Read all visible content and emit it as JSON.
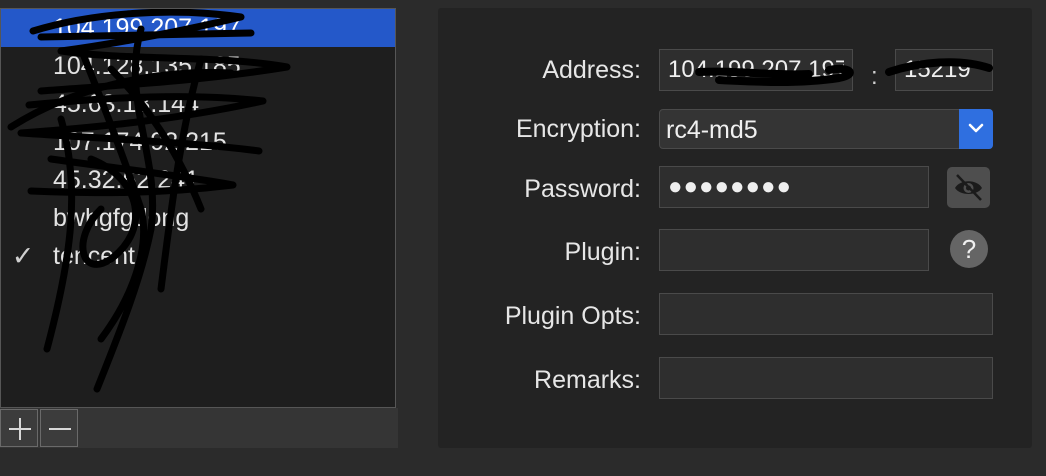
{
  "server_list": {
    "items": [
      {
        "label": "104.199.207.197",
        "selected": true,
        "checked": false
      },
      {
        "label": "104.128.135.185",
        "selected": false,
        "checked": false
      },
      {
        "label": "45.63.18.144",
        "selected": false,
        "checked": false
      },
      {
        "label": "107.174.92.215",
        "selected": false,
        "checked": false
      },
      {
        "label": "45.32.62.241",
        "selected": false,
        "checked": false
      },
      {
        "label": "bwhgfgdong",
        "selected": false,
        "checked": false
      },
      {
        "label": "tencent",
        "selected": false,
        "checked": true
      }
    ],
    "check_glyph": "✓",
    "add_label": "add-server",
    "remove_label": "remove-server"
  },
  "form": {
    "address_label": "Address:",
    "address_value": "104.199.207.197",
    "port_separator": ":",
    "port_value": "15219",
    "encryption_label": "Encryption:",
    "encryption_value": "rc4-md5",
    "password_label": "Password:",
    "password_value": "●●●●●●●●",
    "plugin_label": "Plugin:",
    "plugin_value": "",
    "help_glyph": "?",
    "plugin_opts_label": "Plugin Opts:",
    "plugin_opts_value": "",
    "remarks_label": "Remarks:",
    "remarks_value": ""
  },
  "colors": {
    "selection": "#2458c9",
    "accent": "#2f6fe0",
    "panel": "#232323",
    "background": "#2b2b2b"
  }
}
